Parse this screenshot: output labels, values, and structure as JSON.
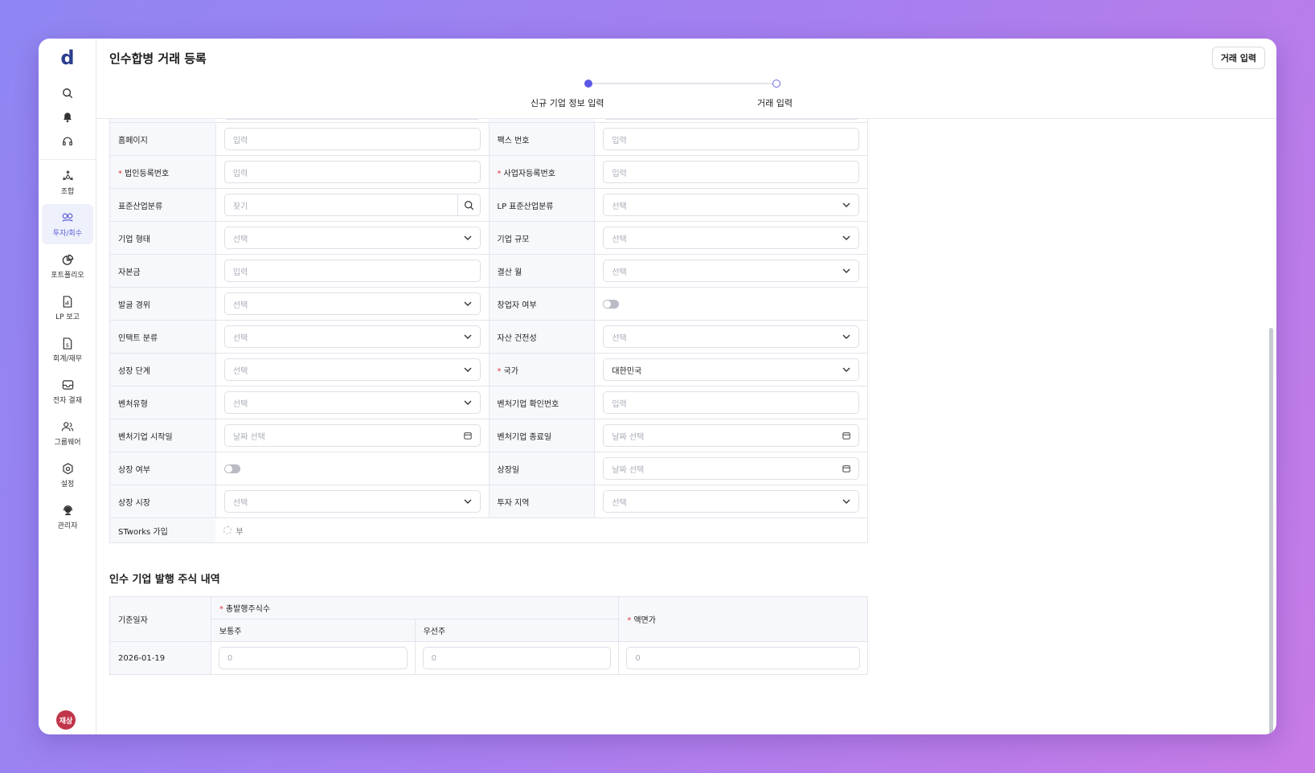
{
  "app": {
    "logo": "d",
    "page_title": "인수합병 거래 등록",
    "header_button": "거래 입력"
  },
  "stepper": {
    "steps": [
      "신규 기업 정보 입력",
      "거래 입력"
    ],
    "current_step": 1
  },
  "sidebar": {
    "items": [
      {
        "label": "조합",
        "icon": "recycle-icon"
      },
      {
        "label": "투자/회수",
        "icon": "link-chain-icon",
        "active": true
      },
      {
        "label": "포트폴리오",
        "icon": "pie-chart-icon"
      },
      {
        "label": "LP 보고",
        "icon": "document-chart-icon"
      },
      {
        "label": "회계/재무",
        "icon": "document-money-icon"
      },
      {
        "label": "전자 결재",
        "icon": "inbox-icon"
      },
      {
        "label": "그룹웨어",
        "icon": "users-icon"
      },
      {
        "label": "설정",
        "icon": "gear-icon"
      },
      {
        "label": "관리자",
        "icon": "headset-user-icon"
      }
    ],
    "avatar": "재상"
  },
  "form": {
    "rows": [
      {
        "l_label": "홈페이지",
        "l_placeholder": "입력",
        "r_label": "팩스 번호",
        "r_placeholder": "입력"
      },
      {
        "l_label": "법인등록번호",
        "l_placeholder": "입력",
        "r_label": "사업자등록번호",
        "r_placeholder": "입력"
      },
      {
        "l_label": "표준산업분류",
        "l_placeholder": "찾기",
        "r_label": "LP 표준산업분류",
        "r_placeholder": "선택"
      },
      {
        "l_label": "기업 형태",
        "l_placeholder": "선택",
        "r_label": "기업 규모",
        "r_placeholder": "선택"
      },
      {
        "l_label": "자본금",
        "l_placeholder": "입력",
        "r_label": "결산 월",
        "r_placeholder": "선택"
      },
      {
        "l_label": "발굴 경위",
        "l_placeholder": "선택",
        "r_label": "창업자 여부"
      },
      {
        "l_label": "인택트 분류",
        "l_placeholder": "선택",
        "r_label": "자산 건전성",
        "r_placeholder": "선택"
      },
      {
        "l_label": "성장 단계",
        "l_placeholder": "선택",
        "r_label": "국가",
        "r_value": "대한민국"
      },
      {
        "l_label": "벤처유형",
        "l_placeholder": "선택",
        "r_label": "벤처기업 확인번호",
        "r_placeholder": "입력"
      },
      {
        "l_label": "벤처기업 시작일",
        "l_placeholder": "날짜 선택",
        "r_label": "벤처기업 종료일",
        "r_placeholder": "날짜 선택"
      },
      {
        "l_label": "상장 여부",
        "r_label": "상장일",
        "r_placeholder": "날짜 선택"
      },
      {
        "l_label": "상장 시장",
        "l_placeholder": "선택",
        "r_label": "투자 지역",
        "r_placeholder": "선택"
      },
      {
        "l_label": "STworks 가입",
        "l_radio": "부"
      }
    ]
  },
  "stock_section": {
    "title": "인수 기업 발행 주식 내역",
    "headers": {
      "base_date": "기준일자",
      "total_shares": "총발행주식수",
      "common": "보통주",
      "preferred": "우선주",
      "par_value": "액면가"
    },
    "row": {
      "base_date": "2026-01-19",
      "common_placeholder": "0",
      "preferred_placeholder": "0",
      "par_value_placeholder": "0"
    }
  },
  "colors": {
    "accent": "#5b57e6",
    "required": "#e0383e",
    "avatar_bg": "#c2364a"
  }
}
